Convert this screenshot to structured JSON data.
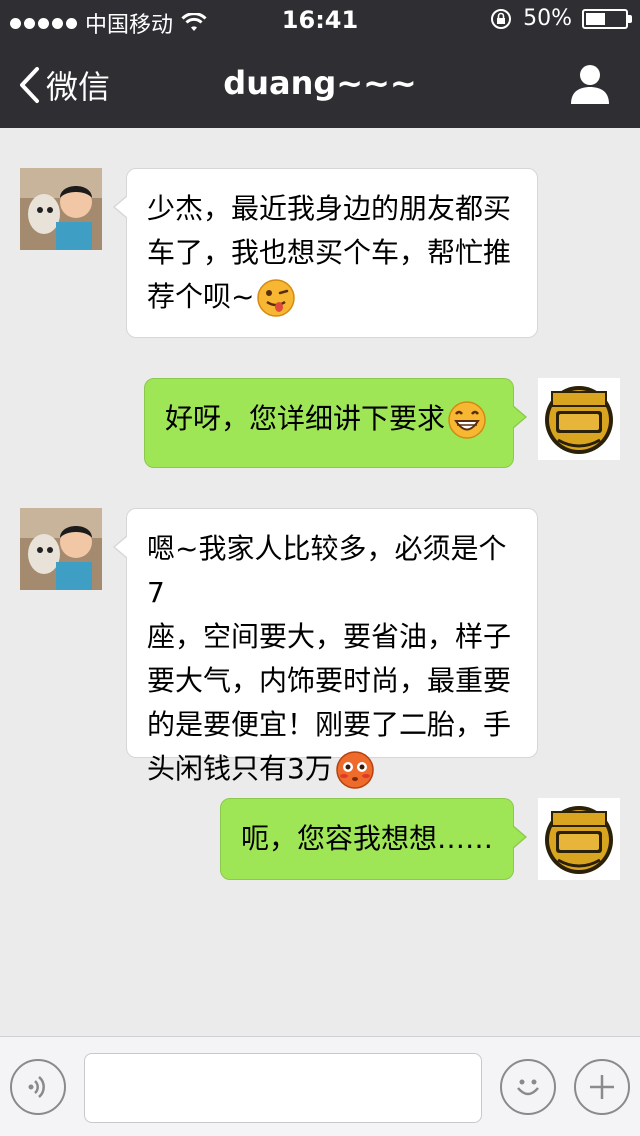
{
  "status_bar": {
    "carrier": "中国移动",
    "time": "16:41",
    "battery_percent": "50%",
    "battery_level": 0.5
  },
  "nav": {
    "back_label": "微信",
    "title": "duang~~~"
  },
  "messages": [
    {
      "side": "in",
      "lines": [
        "少杰，最近我身边的朋友都买",
        "车了，我也想买个车，帮忙推",
        "荐个呗~"
      ],
      "emoji": "winking-tongue-emoji"
    },
    {
      "side": "out",
      "lines": [
        "好呀，您详细讲下要求"
      ],
      "emoji": "grinning-emoji"
    },
    {
      "side": "in",
      "lines": [
        "嗯~我家人比较多，必须是个7",
        "座，空间要大，要省油，样子",
        "要大气，内饰要时尚，最重要",
        "的是要便宜！刚要了二胎，手",
        "头闲钱只有3万"
      ],
      "emoji": "blushing-emoji"
    },
    {
      "side": "out",
      "lines": [
        "呃，您容我想想……"
      ],
      "emoji": null
    }
  ],
  "icons": {
    "voice": "voice-icon",
    "emoji": "emoji-face-icon",
    "plus": "plus-icon",
    "person": "person-icon",
    "back": "chevron-left-icon"
  },
  "colors": {
    "header": "#2e2e33",
    "background": "#ebebeb",
    "outgoing_bubble": "#9fe657",
    "incoming_bubble": "#ffffff"
  }
}
